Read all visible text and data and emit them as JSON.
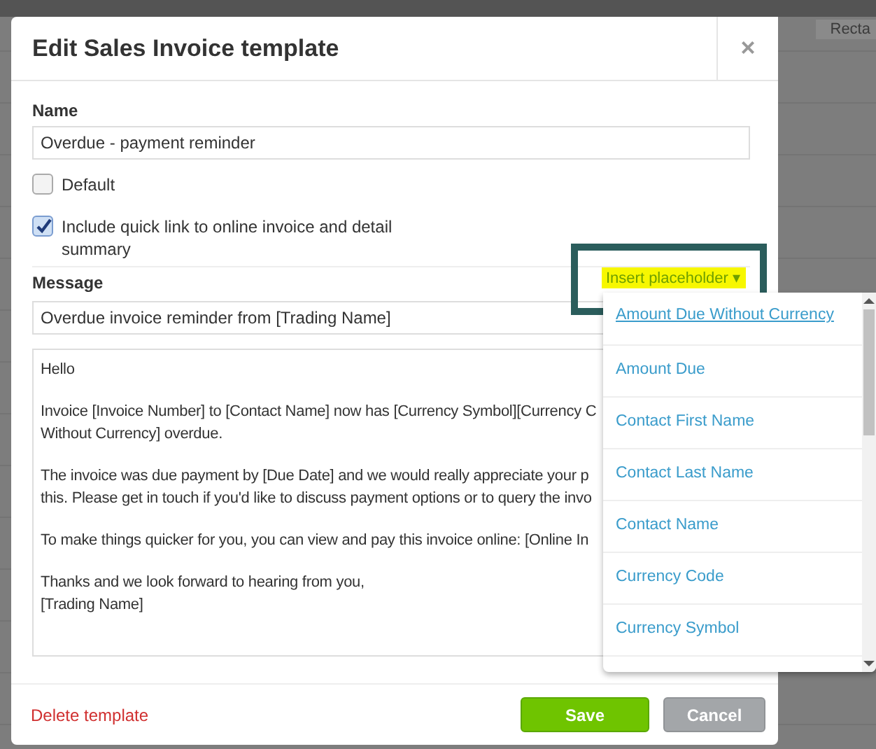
{
  "background": {
    "corner_text": "Recta"
  },
  "dialog": {
    "title": "Edit Sales Invoice template",
    "close": "×",
    "name_label": "Name",
    "name_value": "Overdue - payment reminder",
    "checkboxes": [
      {
        "label": "Default",
        "checked": false
      },
      {
        "label": "Include quick link to online invoice and detail summary",
        "checked": true
      }
    ],
    "message_label": "Message",
    "insert_placeholder": "Insert placeholder ▾",
    "subject_value": "Overdue invoice reminder from [Trading Name]",
    "body_paragraphs": [
      [
        "Hello"
      ],
      [
        "Invoice [Invoice Number] to [Contact Name] now has [Currency Symbol][Currency C",
        "Without Currency] overdue."
      ],
      [
        "The invoice was due payment by [Due Date] and we would really appreciate your p",
        "this. Please get in touch if you'd like to discuss payment options or to query the invo"
      ],
      [
        "To make things quicker for you, you can view and pay this invoice online: [Online In"
      ],
      [
        "Thanks and we look forward to hearing from you,",
        "[Trading Name]"
      ]
    ],
    "delete_link": "Delete template",
    "buttons": [
      {
        "label": "Save",
        "kind": "primary"
      },
      {
        "label": "Cancel",
        "kind": "secondary"
      }
    ]
  },
  "placeholder_menu": {
    "items": [
      {
        "label": "Amount Due Without Currency",
        "selected": true
      },
      {
        "label": "Amount Due",
        "selected": false
      },
      {
        "label": "Contact First Name",
        "selected": false
      },
      {
        "label": "Contact Last Name",
        "selected": false
      },
      {
        "label": "Contact Name",
        "selected": false
      },
      {
        "label": "Currency Code",
        "selected": false
      },
      {
        "label": "Currency Symbol",
        "selected": false
      }
    ]
  }
}
